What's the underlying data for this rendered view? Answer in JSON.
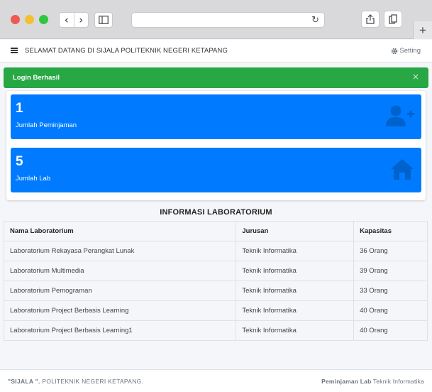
{
  "browser": {
    "back_glyph": "‹",
    "forward_glyph": "›",
    "reload_glyph": "↻",
    "newtab_glyph": "+"
  },
  "navbar": {
    "title": "SELAMAT DATANG DI SIJALA POLITEKNIK NEGERI KETAPANG",
    "setting_label": "Setting",
    "setting_icon": "gear-icon"
  },
  "alert": {
    "message": "Login Berhasil",
    "close_glyph": "×",
    "color": "#28a745"
  },
  "stats": [
    {
      "value": "1",
      "label": "Jumlah Peminjaman",
      "icon": "user-plus-icon"
    },
    {
      "value": "5",
      "label": "Jumlah Lab",
      "icon": "home-icon"
    }
  ],
  "stat_color": "#007bff",
  "lab_table": {
    "title": "INFORMASI LABORATORIUM",
    "headers": [
      "Nama Laboratorium",
      "Jurusan",
      "Kapasitas"
    ],
    "rows": [
      [
        "Laboratorium Rekayasa Perangkat Lunak",
        "Teknik Informatika",
        "36 Orang"
      ],
      [
        "Laboratorium Multimedia",
        "Teknik Informatika",
        "39 Orang"
      ],
      [
        "Laboratorium Pemograman",
        "Teknik Informatika",
        "33 Orang"
      ],
      [
        "Laboratorium Project Berbasis Learning",
        "Teknik Informatika",
        "40 Orang"
      ],
      [
        "Laboratorium Project Berbasis Learning1",
        "Teknik Informatika",
        "40 Orang"
      ]
    ]
  },
  "footer": {
    "left_bold": "\"SIJALA \".",
    "left_text": " POLITEKNIK NEGERI KETAPANG.",
    "right_bold": "Peminjaman Lab",
    "right_text": " Teknik Informatika"
  }
}
